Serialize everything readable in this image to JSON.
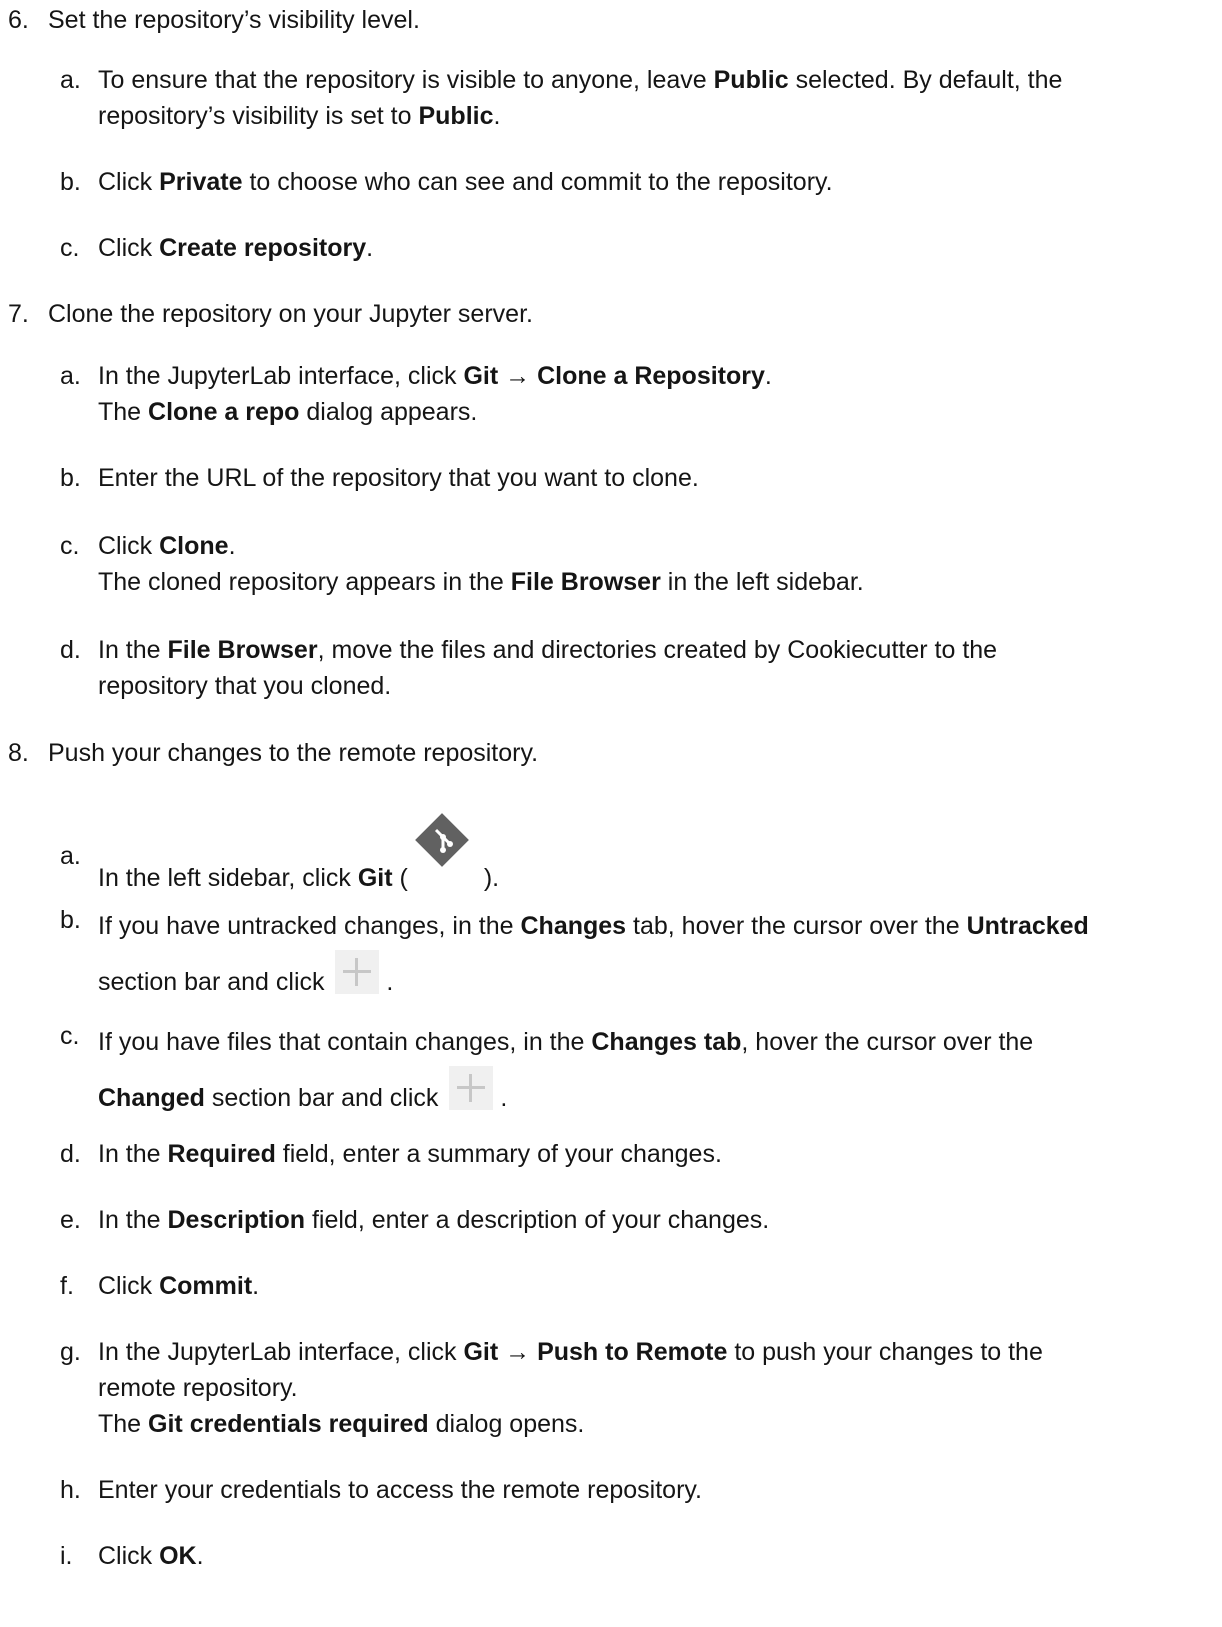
{
  "steps": [
    {
      "num": "6.",
      "text": "Set the repository’s visibility level.",
      "subs": [
        {
          "letter": "a.",
          "p1": "To ensure that the repository is visible to anyone, leave ",
          "b1": "Public",
          "p2": " selected. By default, the",
          "p3": "repository’s visibility is set to ",
          "b2": "Public",
          "p4": "."
        },
        {
          "letter": "b.",
          "p1": "Click ",
          "b1": "Private",
          "p2": " to choose who can see and commit to the repository."
        },
        {
          "letter": "c.",
          "p1": "Click ",
          "b1": "Create repository",
          "p2": "."
        }
      ]
    },
    {
      "num": "7.",
      "text": "Clone the repository on your Jupyter server.",
      "subs": [
        {
          "letter": "a.",
          "p1": "In the JupyterLab interface, click ",
          "b1": "Git → Clone a Repository",
          "p2": ".",
          "p3": "The ",
          "b2": "Clone a repo",
          "p4": " dialog appears."
        },
        {
          "letter": "b.",
          "p1": "Enter the URL of the repository that you want to clone."
        },
        {
          "letter": "c.",
          "p1": "Click ",
          "b1": "Clone",
          "p2": ".",
          "p3": "The cloned repository appears in the ",
          "b2": "File Browser",
          "p4": " in the left sidebar."
        },
        {
          "letter": "d.",
          "p1": "In the ",
          "b1": "File Browser",
          "p2": ", move the files and directories created by Cookiecutter to the",
          "p3": "repository that you cloned."
        }
      ]
    },
    {
      "num": "8.",
      "text": "Push your changes to the remote repository.",
      "subs": [
        {
          "letter": "a.",
          "p1": "In the left sidebar, click ",
          "b1": "Git",
          "p2": " (",
          "p3": ")."
        },
        {
          "letter": "b.",
          "p1": "If you have untracked changes, in the ",
          "b1": "Changes",
          "p2": " tab, hover the cursor over the  ",
          "b2": "Untracked",
          "p3": "section bar and click ",
          "p4": "."
        },
        {
          "letter": "c.",
          "p1": "If you have files that contain changes, in the ",
          "b1": "Changes tab",
          "p2": ", hover the cursor over the",
          "b2": "Changed",
          "p3": " section bar and click ",
          "p4": "."
        },
        {
          "letter": "d.",
          "p1": "In the ",
          "b1": "Required",
          "p2": " field, enter a summary of your changes."
        },
        {
          "letter": "e.",
          "p1": "In the ",
          "b1": "Description",
          "p2": " field, enter a description of your changes."
        },
        {
          "letter": "f.",
          "p1": "Click ",
          "b1": "Commit",
          "p2": "."
        },
        {
          "letter": "g.",
          "p1": "In the JupyterLab interface, click ",
          "b1": "Git → Push to Remote",
          "p2": " to push your changes to the",
          "p3": "remote repository.",
          "p4": "The ",
          "b2": "Git credentials required",
          "p5": " dialog opens."
        },
        {
          "letter": "h.",
          "p1": "Enter your credentials to access the remote repository."
        },
        {
          "letter": "i.",
          "p1": "Click ",
          "b1": "OK",
          "p2": "."
        }
      ]
    }
  ]
}
